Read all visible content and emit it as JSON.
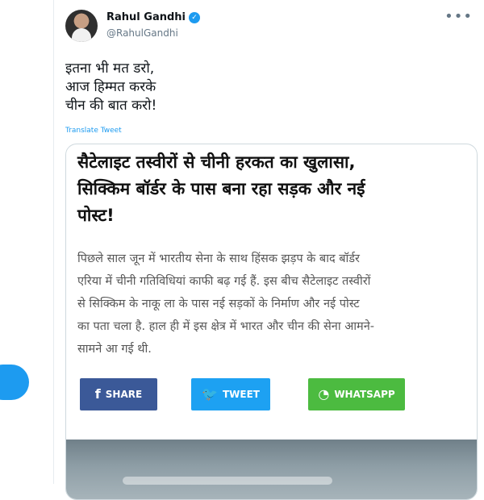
{
  "tweet": {
    "author_name": "Rahul Gandhi",
    "handle": "@RahulGandhi",
    "more_icon": "•••",
    "verified_icon": "✓",
    "text_lines": [
      "इतना भी मत डरो,",
      "आज हिम्मत करके",
      "चीन की बात करो!"
    ],
    "translate_label": "Translate Tweet"
  },
  "card": {
    "headline_lines": [
      "सैटेलाइट तस्वीरों से चीनी हरकत का खुलासा,",
      "सिक्किम बॉर्डर के पास बना रहा सड़क और नई",
      "पोस्ट!"
    ],
    "body_lines": [
      "पिछले साल जून में भारतीय सेना के साथ हिंसक झड़प के बाद बॉर्डर",
      "एरिया में चीनी गतिविधियां काफी बढ़ गई हैं. इस बीच सैटेलाइट तस्वीरों",
      "से सिक्किम के नाकू ला के पास नई सड़कों के निर्माण और नई पोस्ट",
      "का पता चला है. हाल ही में इस क्षेत्र में भारत और चीन की सेना आमने-",
      "सामने आ गई थी."
    ],
    "buttons": {
      "share": "SHARE",
      "tweet": "TWEET",
      "whatsapp": "WHATSAPP"
    }
  },
  "colors": {
    "twitter_blue": "#1d9bf0",
    "facebook_blue": "#3b5998",
    "whatsapp_green": "#4cbb40"
  }
}
